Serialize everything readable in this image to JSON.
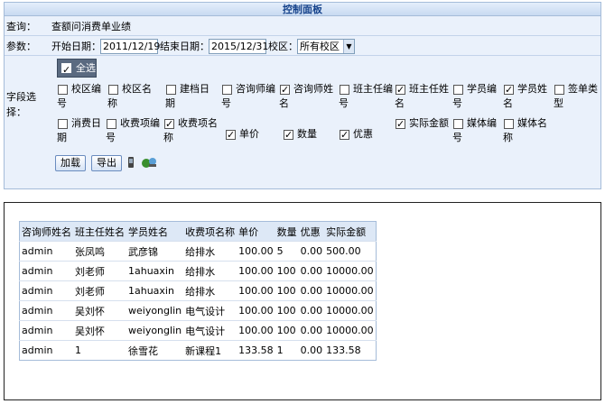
{
  "panel": {
    "title": "控制面板"
  },
  "query": {
    "label": "查询：",
    "value": "查额问消费单业绩"
  },
  "params": {
    "label": "参数：",
    "start_label": "开始日期：",
    "start_value": "2011/12/19",
    "end_label": "结束日期：",
    "end_value": "2015/12/31",
    "campus_label": "校区：",
    "campus_value": "所有校区"
  },
  "fields": {
    "label": "字段选择：",
    "select_all": "全选",
    "items": [
      {
        "label": "校区编号",
        "checked": false
      },
      {
        "label": "校区名称",
        "checked": false
      },
      {
        "label": "建档日期",
        "checked": false
      },
      {
        "label": "咨询师编号",
        "checked": false
      },
      {
        "label": "咨询师姓名",
        "checked": true
      },
      {
        "label": "班主任编号",
        "checked": false
      },
      {
        "label": "班主任姓名",
        "checked": true
      },
      {
        "label": "学员编号",
        "checked": false
      },
      {
        "label": "学员姓名",
        "checked": true
      },
      {
        "label": "签单类型",
        "checked": false
      },
      {
        "label": "消费日期",
        "checked": false
      },
      {
        "label": "收费项编号",
        "checked": false
      },
      {
        "label": "收费项名称",
        "checked": true
      },
      {
        "label": "单价",
        "checked": true
      },
      {
        "label": "数量",
        "checked": true
      },
      {
        "label": "优惠",
        "checked": true
      },
      {
        "label": "实际金额",
        "checked": true
      },
      {
        "label": "媒体编号",
        "checked": false
      },
      {
        "label": "媒体名称",
        "checked": false
      }
    ]
  },
  "buttons": {
    "load": "加载",
    "export": "导出"
  },
  "table": {
    "headers": [
      "咨询师姓名",
      "班主任姓名",
      "学员姓名",
      "收费项名称",
      "单价",
      "数量",
      "优惠",
      "实际金额"
    ],
    "rows": [
      [
        "admin",
        "张凤鸣",
        "武彦锦",
        "给排水",
        "100.00",
        "5",
        "0.00",
        "500.00"
      ],
      [
        "admin",
        "刘老师",
        "1ahuaxin",
        "给排水",
        "100.00",
        "100",
        "0.00",
        "10000.00"
      ],
      [
        "admin",
        "刘老师",
        "1ahuaxin",
        "给排水",
        "100.00",
        "100",
        "0.00",
        "10000.00"
      ],
      [
        "admin",
        "吴刘怀",
        "weiyonglin",
        "电气设计",
        "100.00",
        "100",
        "0.00",
        "10000.00"
      ],
      [
        "admin",
        "吴刘怀",
        "weiyonglin",
        "电气设计",
        "100.00",
        "100",
        "0.00",
        "10000.00"
      ],
      [
        "admin",
        "1",
        "徐雪花",
        "新课程1",
        "133.58",
        "1",
        "0.00",
        "133.58"
      ]
    ]
  }
}
